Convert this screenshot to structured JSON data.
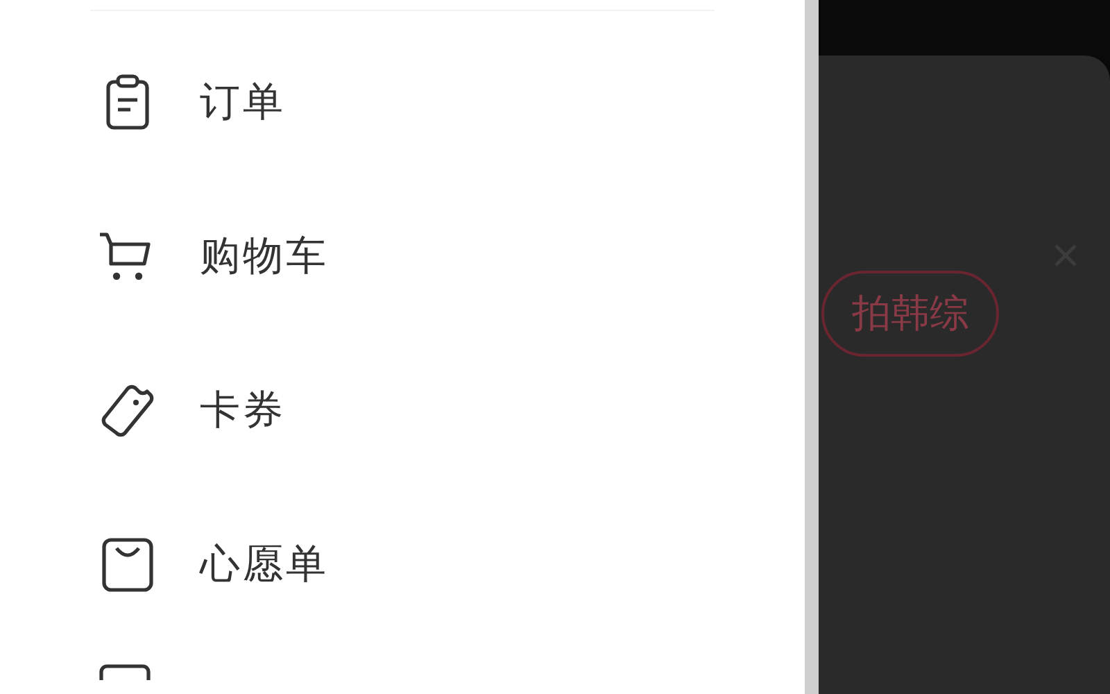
{
  "menu": [
    {
      "label": "订单"
    },
    {
      "label": "购物车"
    },
    {
      "label": "卡券"
    },
    {
      "label": "心愿单"
    }
  ],
  "overlay": {
    "tag": "拍韩综"
  }
}
